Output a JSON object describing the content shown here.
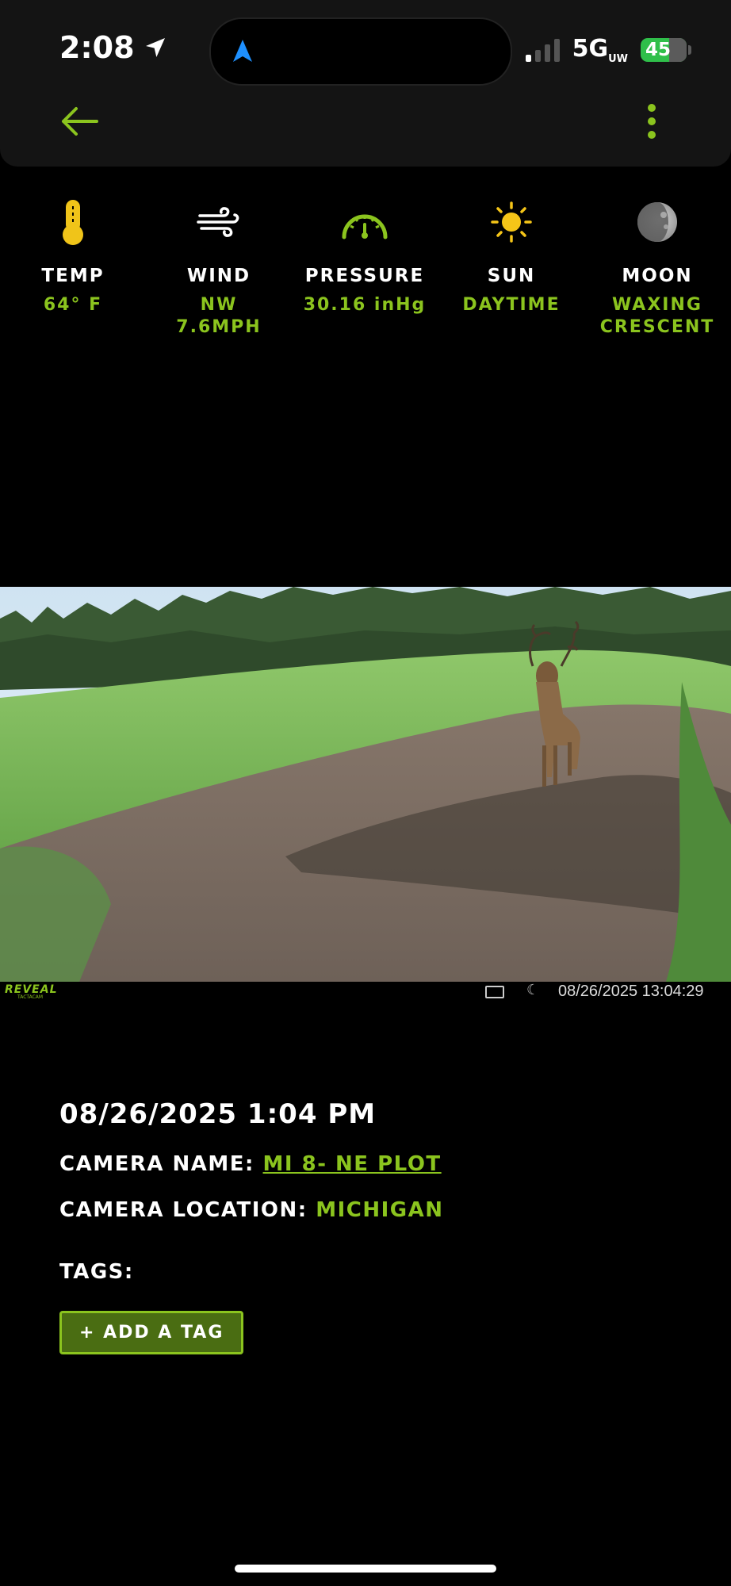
{
  "status_bar": {
    "time": "2:08",
    "network": "5G",
    "network_sub": "UW",
    "battery": "45"
  },
  "weather": [
    {
      "icon": "thermometer-icon",
      "label": "TEMP",
      "value": "64° F"
    },
    {
      "icon": "wind-icon",
      "label": "WIND",
      "value": "NW\n7.6MPH"
    },
    {
      "icon": "gauge-icon",
      "label": "PRESSURE",
      "value": "30.16 inHg"
    },
    {
      "icon": "sun-icon",
      "label": "SUN",
      "value": "DAYTIME"
    },
    {
      "icon": "moon-icon",
      "label": "MOON",
      "value": "WAXING\nCRESCENT"
    }
  ],
  "camera_overlay": {
    "logo": "REVEAL",
    "logo_sub": "TACTACAM",
    "timestamp": "08/26/2025  13:04:29"
  },
  "details": {
    "datetime": "08/26/2025 1:04 PM",
    "camera_name_label": "CAMERA NAME:",
    "camera_name": "MI 8- NE PLOT",
    "camera_location_label": "CAMERA LOCATION:",
    "camera_location": "MICHIGAN",
    "tags_label": "TAGS:",
    "add_tag_button": "+ ADD A TAG"
  },
  "colors": {
    "accent": "#8bc41e",
    "background": "#000000",
    "header": "#141414",
    "thermo": "#f0c419",
    "sun": "#f5c518"
  }
}
